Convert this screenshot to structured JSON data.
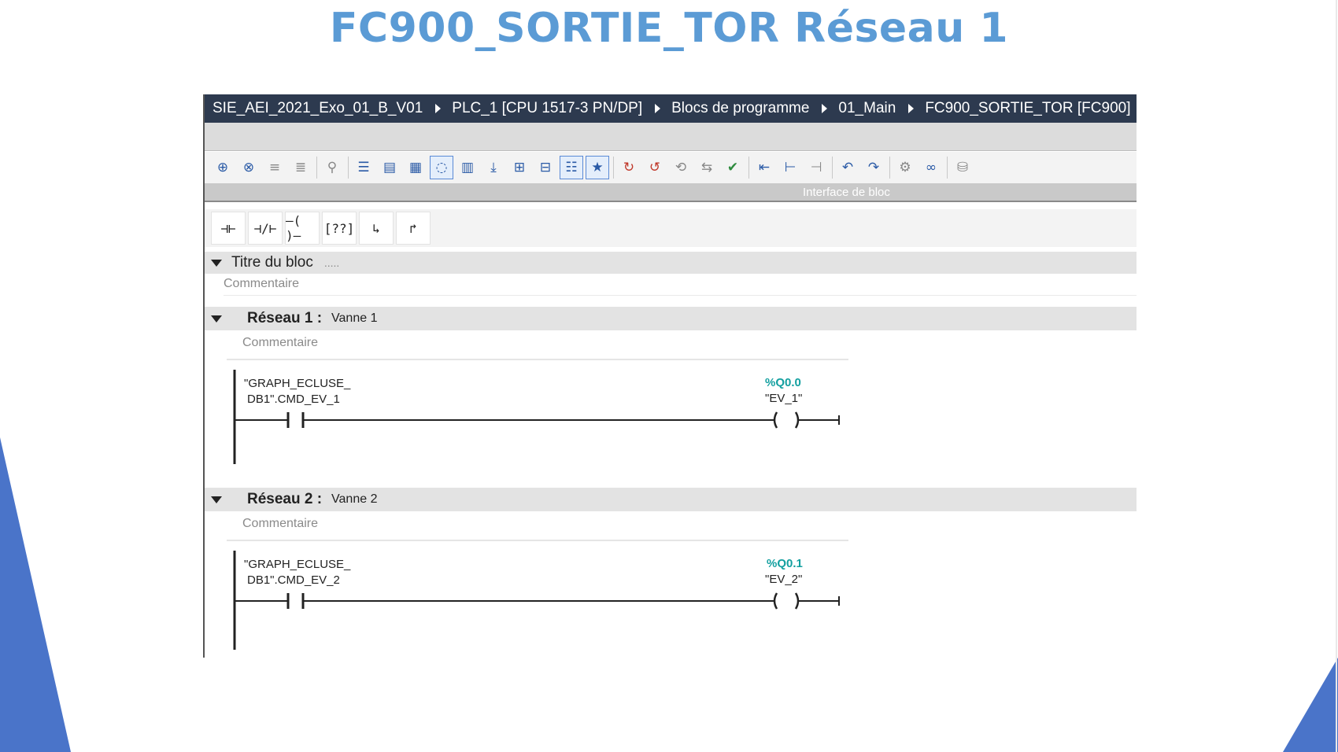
{
  "slide": {
    "title": "FC900_SORTIE_TOR Réseau 1"
  },
  "breadcrumb": [
    "SIE_AEI_2021_Exo_01_B_V01",
    "PLC_1 [CPU 1517-3 PN/DP]",
    "Blocs de programme",
    "01_Main",
    "FC900_SORTIE_TOR [FC900]"
  ],
  "block_interface": {
    "label": "Interface de bloc"
  },
  "block": {
    "title": "Titre du bloc",
    "dots": ".....",
    "comment": "Commentaire"
  },
  "networks": [
    {
      "label": "Réseau 1 :",
      "name": "Vanne 1",
      "comment": "Commentaire",
      "contact_line1": "\"GRAPH_ECLUSE_",
      "contact_line2": "DB1\".CMD_EV_1",
      "coil_address": "%Q0.0",
      "coil_name": "\"EV_1\""
    },
    {
      "label": "Réseau 2 :",
      "name": "Vanne 2",
      "comment": "Commentaire",
      "contact_line1": "\"GRAPH_ECLUSE_",
      "contact_line2": "DB1\".CMD_EV_2",
      "coil_address": "%Q0.1",
      "coil_name": "\"EV_2\""
    }
  ],
  "colors": {
    "title": "#5b9bd5",
    "breadcrumb_bg": "#2d3a4f",
    "address": "#14a0a0",
    "decor": "#4a74c9"
  },
  "ladder_toolbar": [
    "contact-no-icon",
    "contact-nc-icon",
    "coil-icon",
    "empty-box-icon",
    "open-branch-icon",
    "close-branch-icon"
  ],
  "toolbar_icons": [
    "insert-network-icon",
    "delete-network-icon",
    "insert-row-icon",
    "add-row-icon",
    "browse-icon",
    "toggle-absolute-icon",
    "favorites-view-icon",
    "favorites-icon",
    "comments-icon",
    "network-overview-icon",
    "download-icon",
    "expand-icon",
    "collapse-icon",
    "list-view-icon",
    "favorite-star-icon",
    "go-to-error-icon",
    "delete-breakpoint-icon",
    "reset-icon",
    "compare-icon",
    "upload-icon",
    "call-structure-icon",
    "assignment-list-icon",
    "cross-reference-icon",
    "goto-previous-icon",
    "goto-next-icon",
    "monitor-icon",
    "glasses-icon",
    "database-icon"
  ]
}
